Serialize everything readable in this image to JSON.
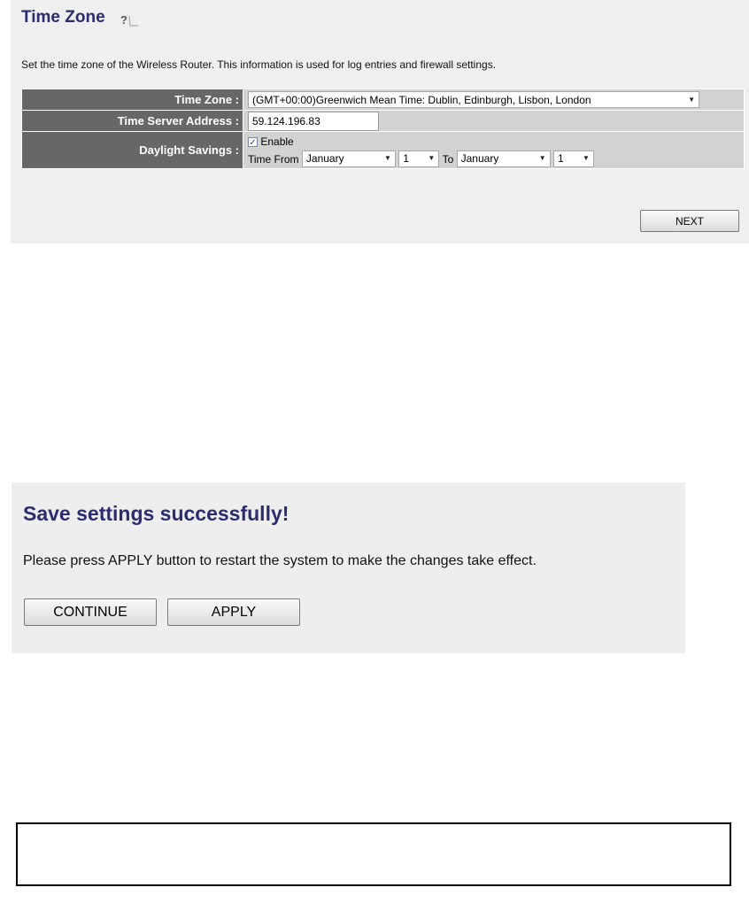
{
  "timezone_panel": {
    "title": "Time Zone",
    "description": "Set the time zone of the Wireless Router. This information is used for log entries and firewall settings.",
    "rows": {
      "time_zone_label": "Time Zone :",
      "time_zone_value": "(GMT+00:00)Greenwich Mean Time: Dublin, Edinburgh, Lisbon, London",
      "time_server_label": "Time Server Address :",
      "time_server_value": "59.124.196.83",
      "daylight_label": "Daylight Savings :",
      "enable_label": "Enable",
      "enable_checked": true,
      "time_from_label": "Time From",
      "from_month": "January",
      "from_day": "1",
      "to_label": "To",
      "to_month": "January",
      "to_day": "1"
    },
    "next_label": "NEXT"
  },
  "save_panel": {
    "title": "Save settings successfully!",
    "message": "Please press APPLY button to restart the system to make the changes take effect.",
    "continue_label": "CONTINUE",
    "apply_label": "APPLY"
  },
  "icons": {
    "help": "help-icon",
    "checkbox": "checkbox-check-icon",
    "dropdown": "dropdown-caret-icon"
  },
  "colors": {
    "title": "#2b2d6e",
    "label_bg": "#676767",
    "value_bg": "#d2d2d2",
    "panel_bg": "#efefef"
  }
}
